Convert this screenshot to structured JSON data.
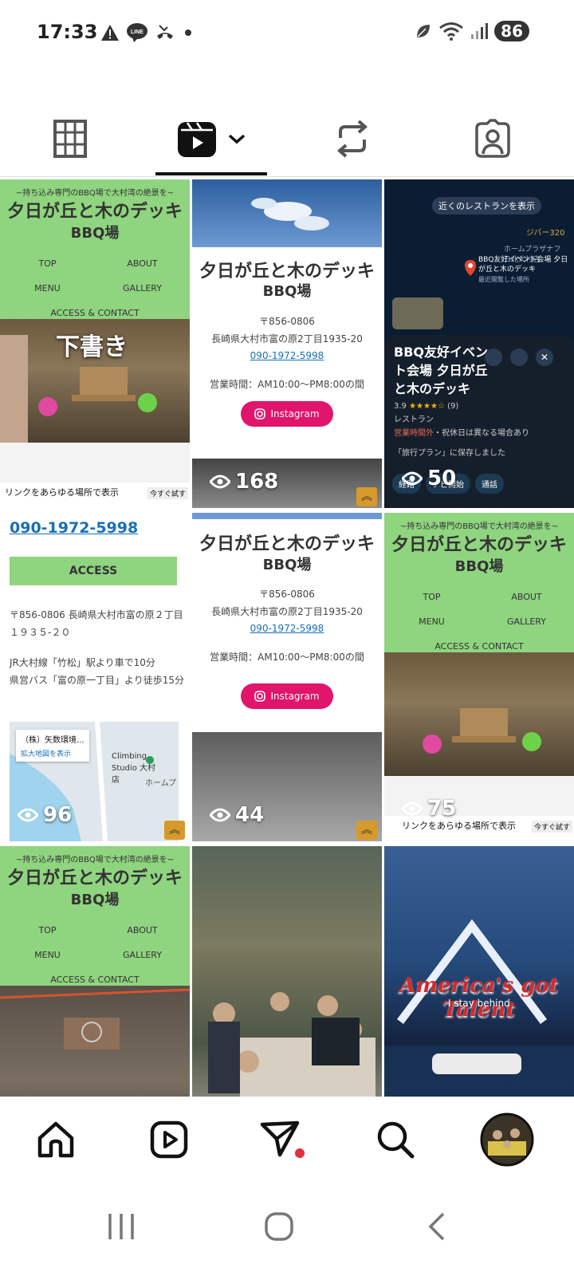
{
  "status_bar": {
    "time": "17:33",
    "battery": "86",
    "icons": [
      "warning-icon",
      "line-icon",
      "missed-call-icon",
      "dot-icon"
    ],
    "right_icons": [
      "leaf-icon",
      "wifi-icon",
      "signal-icon"
    ]
  },
  "tabs": [
    {
      "name": "grid-tab",
      "icon": "grid-icon"
    },
    {
      "name": "reels-tab",
      "icon": "reels-icon",
      "active": true
    },
    {
      "name": "reposts-tab",
      "icon": "repost-icon"
    },
    {
      "name": "tagged-tab",
      "icon": "tagged-icon"
    }
  ],
  "site": {
    "tagline": "~持ち込み専門のBBQ場で大村湾の絶景を~",
    "title_line1": "夕日が丘と木のデッキ",
    "title_line2": "BBQ場",
    "menu_top": "TOP",
    "menu_about": "ABOUT",
    "menu_menu": "MENU",
    "menu_gallery": "GALLERY",
    "menu_access": "ACCESS & CONTACT",
    "zip": "〒856-0806",
    "address": "長崎県大村市富の原2丁目1935-20",
    "phone": "090-1972-5998",
    "hours": "営業時間：AM10:00〜PM8:00の間",
    "instagram": "Instagram",
    "access_heading": "ACCESS",
    "addr_full": "〒856-0806 長崎県大村市富の原２丁目１９３５-２０",
    "directions_1": "JR大村線「竹松」駅より車で10分",
    "directions_2": "県営バス「富の原一丁目」より徒歩15分",
    "link_banner": "リンクをあらゆる場所で表示",
    "try_now": "今すぐ試す",
    "draft_label": "下書き"
  },
  "map_card": {
    "nearby": "近くのレストランを表示",
    "station": "ジバー320",
    "plaza": "ホームプラザナフコ北大村店",
    "pin_label": "BBQ友好イベント会場 夕日が丘と木のデッキ",
    "pin_sub": "最近閲覧した場所",
    "place_name": "BBQ友好イベント会場 夕日が丘と木のデッキ",
    "rating": "3.9",
    "reviews": "(9)",
    "category": "レストラン",
    "hours_status": "営業時間外",
    "hours_note": "・祝休日は異なる場合あり",
    "saved": "「旅行プラン」に保存しました",
    "btn_route": "経路",
    "btn_nav": "ナビ開始",
    "btn_call": "通話"
  },
  "mini_map": {
    "company": "（株）矢数環境...",
    "link": "拡大地図を表示",
    "place": "Climbing Studio 大村店",
    "home": "ホームプ"
  },
  "agt": {
    "logo": "America's got Talent",
    "subtitle": "I stay behind"
  },
  "grid": [
    {
      "views": ""
    },
    {
      "views": "168"
    },
    {
      "views": "50"
    },
    {
      "views": "96"
    },
    {
      "views": "44"
    },
    {
      "views": "75"
    },
    {
      "views": ""
    },
    {
      "views": ""
    },
    {
      "views": ""
    }
  ],
  "bottom_nav": [
    {
      "name": "home-tab",
      "icon": "home-icon"
    },
    {
      "name": "reels-nav-tab",
      "icon": "reels-icon"
    },
    {
      "name": "direct-tab",
      "icon": "send-icon"
    },
    {
      "name": "search-tab",
      "icon": "search-icon"
    },
    {
      "name": "profile-tab",
      "icon": "avatar"
    }
  ],
  "colors": {
    "accent_pink": "#e0156b",
    "notif_red": "#e0303c",
    "site_green": "#8fd47f"
  }
}
